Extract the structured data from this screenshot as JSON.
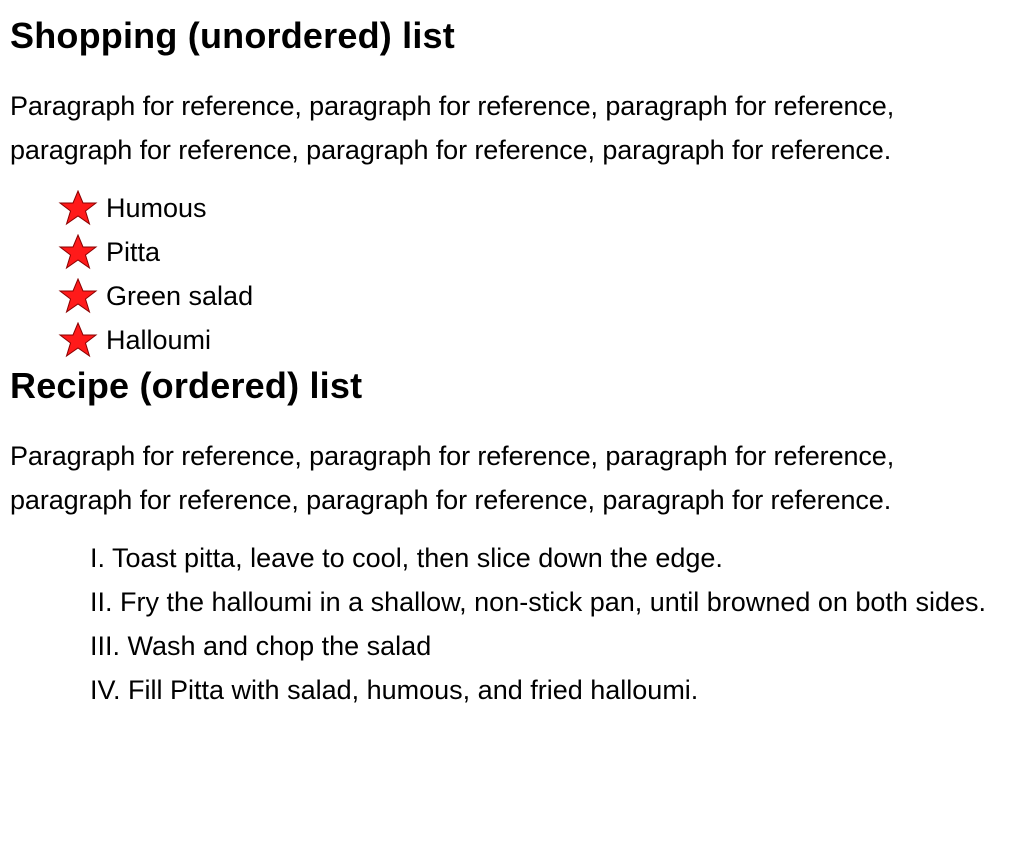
{
  "shopping": {
    "heading": "Shopping (unordered) list",
    "paragraph": "Paragraph for reference, paragraph for reference, paragraph for reference, paragraph for reference, paragraph for reference, paragraph for reference.",
    "bullet_icon": "red-star-icon",
    "bullet_color": "#ff1a1a",
    "items": [
      {
        "label": "Humous"
      },
      {
        "label": "Pitta"
      },
      {
        "label": "Green salad"
      },
      {
        "label": "Halloumi"
      }
    ]
  },
  "recipe": {
    "heading": "Recipe (ordered) list",
    "paragraph": "Paragraph for reference, paragraph for reference, paragraph for reference, paragraph for reference, paragraph for reference, paragraph for reference.",
    "steps": [
      {
        "text": "I. Toast pitta, leave to cool, then slice down the edge."
      },
      {
        "text": "II. Fry the halloumi in a shallow, non-stick pan, until browned on both sides."
      },
      {
        "text": "III. Wash and chop the salad"
      },
      {
        "text": "IV. Fill Pitta with salad, humous, and fried halloumi."
      }
    ]
  }
}
